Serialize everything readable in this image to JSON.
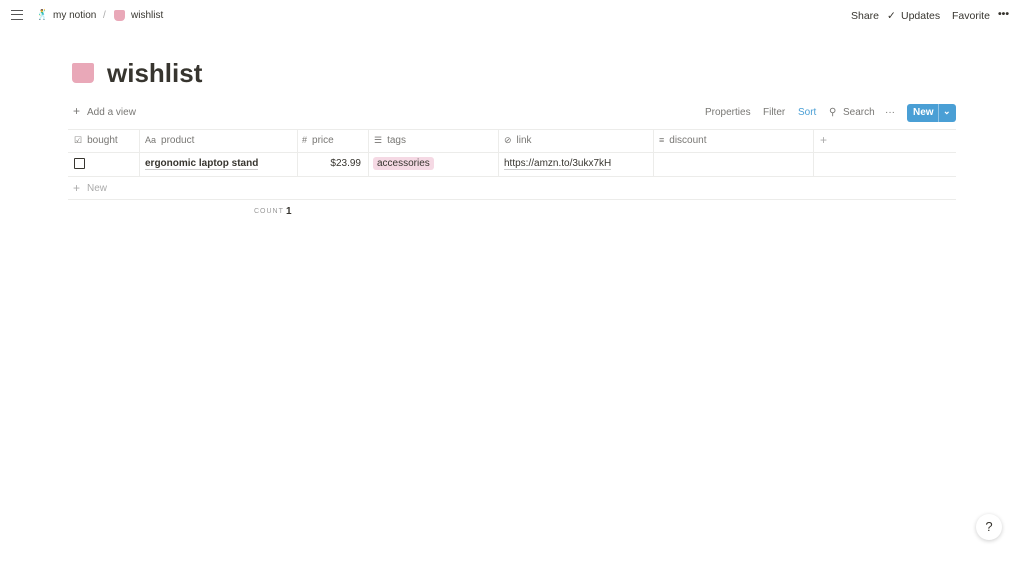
{
  "topbar": {
    "breadcrumb": [
      {
        "label": "my notion",
        "icon": "dancer-emoji-icon"
      },
      {
        "label": "wishlist",
        "icon": "shopping-bags-icon"
      }
    ],
    "separator": "/",
    "share": "Share",
    "updates": "Updates",
    "favorite": "Favorite",
    "more": "•••"
  },
  "page": {
    "title": "wishlist",
    "icon": "shopping-bags-icon"
  },
  "toolbar": {
    "add_view": "Add a view",
    "properties": "Properties",
    "filter": "Filter",
    "sort": "Sort",
    "search": "Search",
    "more": "···",
    "new": "New",
    "accent": "#4a9fd5"
  },
  "table": {
    "columns": [
      {
        "label": "bought",
        "icon": "☑"
      },
      {
        "label": "product",
        "icon": "Aa"
      },
      {
        "label": "price",
        "icon": "#"
      },
      {
        "label": "tags",
        "icon": "☰"
      },
      {
        "label": "link",
        "icon": "⊘"
      },
      {
        "label": "discount",
        "icon": "≡"
      }
    ],
    "add_column": "+",
    "rows": [
      {
        "bought": false,
        "product": "ergonomic laptop stand",
        "price": "$23.99",
        "tags": "accessories",
        "link": "https://amzn.to/3ukx7kH",
        "discount": ""
      }
    ],
    "new_row": "New",
    "count_label": "COUNT",
    "count": "1"
  },
  "help": "?"
}
